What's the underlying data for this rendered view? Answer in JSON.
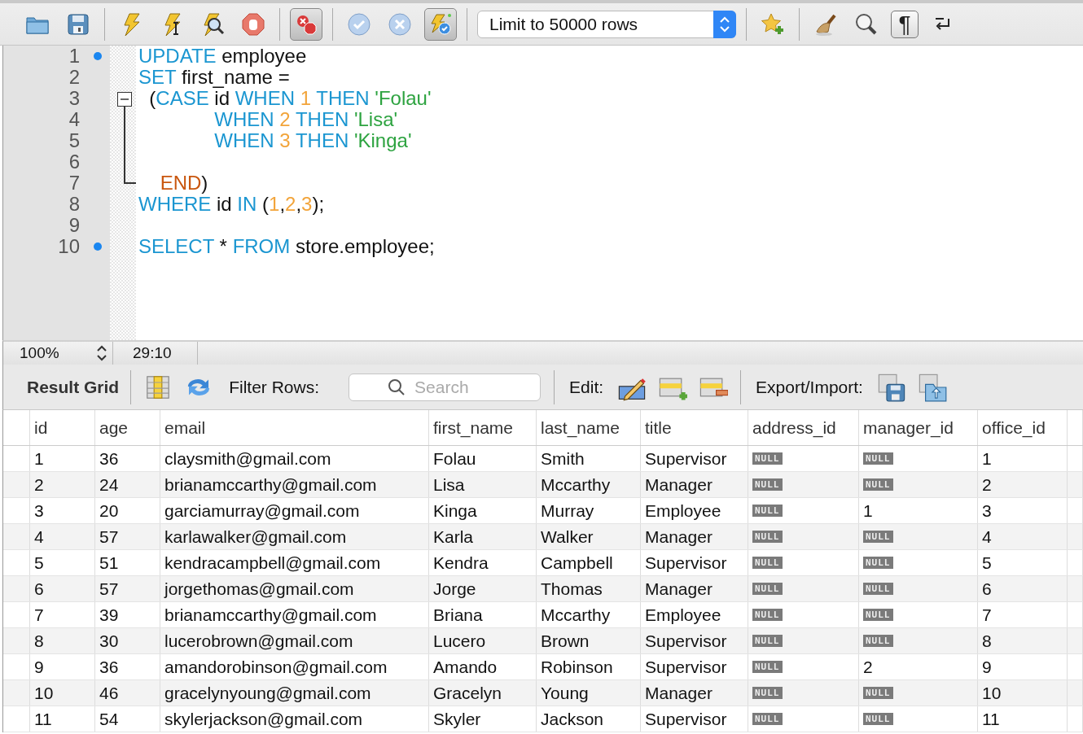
{
  "toolbar": {
    "groups": [
      {
        "buttons": [
          {
            "kind": "open",
            "pressed": false
          },
          {
            "kind": "save",
            "pressed": false
          }
        ]
      },
      {
        "buttons": [
          {
            "kind": "execute",
            "pressed": false
          },
          {
            "kind": "execute-current",
            "pressed": false
          },
          {
            "kind": "explain",
            "pressed": false
          },
          {
            "kind": "stop",
            "pressed": false
          }
        ]
      },
      {
        "buttons": [
          {
            "kind": "stop-on-error",
            "pressed": true
          }
        ]
      },
      {
        "buttons": [
          {
            "kind": "commit",
            "pressed": false
          },
          {
            "kind": "rollback",
            "pressed": false
          },
          {
            "kind": "autocommit",
            "pressed": true
          }
        ]
      },
      {
        "select": "Limit to 50000 rows"
      },
      {
        "buttons": [
          {
            "kind": "add-snippet",
            "pressed": false
          }
        ]
      },
      {
        "buttons": [
          {
            "kind": "beautify",
            "pressed": false
          },
          {
            "kind": "find",
            "pressed": false
          },
          {
            "kind": "invisibles",
            "label": "¶",
            "pressed": false
          },
          {
            "kind": "wrap",
            "pressed": false
          }
        ]
      }
    ]
  },
  "editor": {
    "lines": [
      {
        "number": "1",
        "marker": true,
        "tokens": [
          {
            "kind": "keyword",
            "text": "UPDATE "
          },
          {
            "kind": "plain",
            "text": "employee"
          }
        ]
      },
      {
        "number": "2",
        "marker": false,
        "tokens": [
          {
            "kind": "keyword",
            "text": "SET "
          },
          {
            "kind": "plain",
            "text": "first_name ="
          }
        ]
      },
      {
        "number": "3",
        "marker": false,
        "kind": "fold-start",
        "tokens": [
          {
            "kind": "plain",
            "text": "  ("
          },
          {
            "kind": "keyword",
            "text": "CASE"
          },
          {
            "kind": "plain",
            "text": " id "
          },
          {
            "kind": "keyword",
            "text": "WHEN "
          },
          {
            "kind": "number",
            "text": "1 "
          },
          {
            "kind": "keyword",
            "text": "THEN "
          },
          {
            "kind": "string",
            "text": "'Folau'"
          }
        ]
      },
      {
        "number": "4",
        "marker": false,
        "kind": "fold-inside",
        "tokens": [
          {
            "kind": "keyword",
            "text": "              WHEN "
          },
          {
            "kind": "number",
            "text": "2 "
          },
          {
            "kind": "keyword",
            "text": "THEN "
          },
          {
            "kind": "string",
            "text": "'Lisa'"
          }
        ]
      },
      {
        "number": "5",
        "marker": false,
        "kind": "fold-inside",
        "tokens": [
          {
            "kind": "keyword",
            "text": "              WHEN "
          },
          {
            "kind": "number",
            "text": "3 "
          },
          {
            "kind": "keyword",
            "text": "THEN "
          },
          {
            "kind": "string",
            "text": "'Kinga'"
          }
        ]
      },
      {
        "number": "6",
        "marker": false,
        "kind": "fold-inside"
      },
      {
        "number": "7",
        "marker": false,
        "kind": "fold-end",
        "tokens": [
          {
            "kind": "block",
            "text": "    END"
          },
          {
            "kind": "plain",
            "text": ")"
          }
        ]
      },
      {
        "number": "8",
        "marker": false,
        "tokens": [
          {
            "kind": "keyword",
            "text": "WHERE"
          },
          {
            "kind": "plain",
            "text": " id "
          },
          {
            "kind": "keyword",
            "text": "IN"
          },
          {
            "kind": "plain",
            "text": " ("
          },
          {
            "kind": "number",
            "text": "1"
          },
          {
            "kind": "plain",
            "text": ","
          },
          {
            "kind": "number",
            "text": "2"
          },
          {
            "kind": "plain",
            "text": ","
          },
          {
            "kind": "number",
            "text": "3"
          },
          {
            "kind": "plain",
            "text": ");"
          }
        ]
      },
      {
        "number": "9",
        "marker": false
      },
      {
        "number": "10",
        "marker": true,
        "tokens": [
          {
            "kind": "keyword",
            "text": "SELECT"
          },
          {
            "kind": "plain",
            "text": " * "
          },
          {
            "kind": "keyword",
            "text": "FROM"
          },
          {
            "kind": "plain",
            "text": " store.employee;"
          }
        ]
      }
    ]
  },
  "status_bar": {
    "zoom": "100%",
    "position": "29:10"
  },
  "result_toolbar": {
    "title": "Result Grid",
    "filter_label": "Filter Rows:",
    "search": {
      "placeholder": "Search"
    },
    "edit_label": "Edit:",
    "export_label": "Export/Import:"
  },
  "table": {
    "columns": [
      "id",
      "age",
      "email",
      "first_name",
      "last_name",
      "title",
      "address_id",
      "manager_id",
      "office_id"
    ],
    "rows": [
      [
        "1",
        "36",
        "claysmith@gmail.com",
        "Folau",
        "Smith",
        "Supervisor",
        {
          "kind": "null",
          "text": "NULL"
        },
        {
          "kind": "null",
          "text": "NULL"
        },
        "1"
      ],
      [
        "2",
        "24",
        "brianamccarthy@gmail.com",
        "Lisa",
        "Mccarthy",
        "Manager",
        {
          "kind": "null",
          "text": "NULL"
        },
        {
          "kind": "null",
          "text": "NULL"
        },
        "2"
      ],
      [
        "3",
        "20",
        "garciamurray@gmail.com",
        "Kinga",
        "Murray",
        "Employee",
        {
          "kind": "null",
          "text": "NULL"
        },
        "1",
        "3"
      ],
      [
        "4",
        "57",
        "karlawalker@gmail.com",
        "Karla",
        "Walker",
        "Manager",
        {
          "kind": "null",
          "text": "NULL"
        },
        {
          "kind": "null",
          "text": "NULL"
        },
        "4"
      ],
      [
        "5",
        "51",
        "kendracampbell@gmail.com",
        "Kendra",
        "Campbell",
        "Supervisor",
        {
          "kind": "null",
          "text": "NULL"
        },
        {
          "kind": "null",
          "text": "NULL"
        },
        "5"
      ],
      [
        "6",
        "57",
        "jorgethomas@gmail.com",
        "Jorge",
        "Thomas",
        "Manager",
        {
          "kind": "null",
          "text": "NULL"
        },
        {
          "kind": "null",
          "text": "NULL"
        },
        "6"
      ],
      [
        "7",
        "39",
        "brianamccarthy@gmail.com",
        "Briana",
        "Mccarthy",
        "Employee",
        {
          "kind": "null",
          "text": "NULL"
        },
        {
          "kind": "null",
          "text": "NULL"
        },
        "7"
      ],
      [
        "8",
        "30",
        "lucerobrown@gmail.com",
        "Lucero",
        "Brown",
        "Supervisor",
        {
          "kind": "null",
          "text": "NULL"
        },
        {
          "kind": "null",
          "text": "NULL"
        },
        "8"
      ],
      [
        "9",
        "36",
        "amandorobinson@gmail.com",
        "Amando",
        "Robinson",
        "Supervisor",
        {
          "kind": "null",
          "text": "NULL"
        },
        "2",
        "9"
      ],
      [
        "10",
        "46",
        "gracelynyoung@gmail.com",
        "Gracelyn",
        "Young",
        "Manager",
        {
          "kind": "null",
          "text": "NULL"
        },
        {
          "kind": "null",
          "text": "NULL"
        },
        "10"
      ],
      [
        "11",
        "54",
        "skylerjackson@gmail.com",
        "Skyler",
        "Jackson",
        "Supervisor",
        {
          "kind": "null",
          "text": "NULL"
        },
        {
          "kind": "null",
          "text": "NULL"
        },
        "11"
      ]
    ]
  }
}
